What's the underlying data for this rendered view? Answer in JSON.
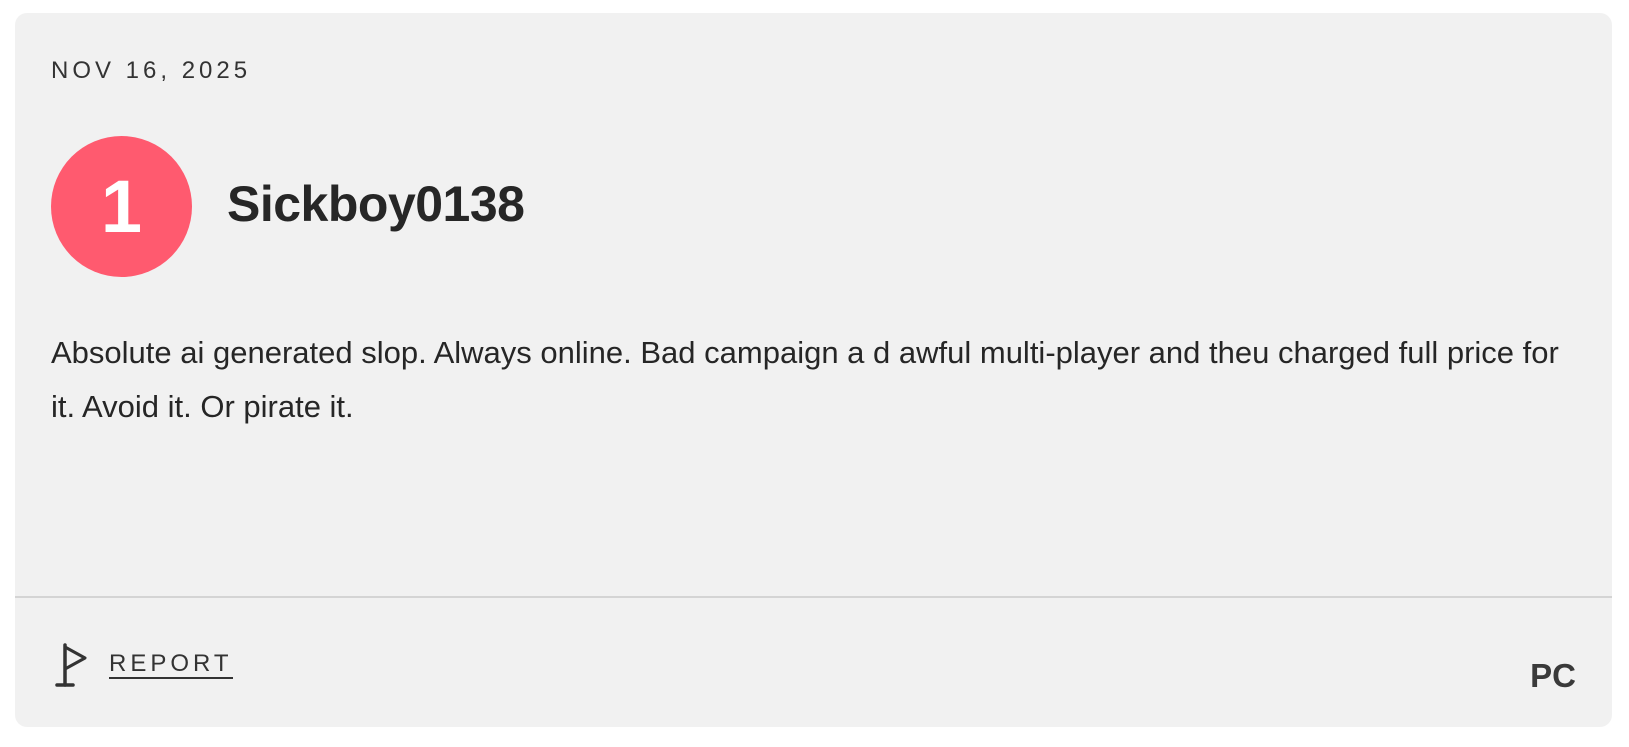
{
  "review": {
    "date": "NOV 16, 2025",
    "score": "1",
    "score_color": "#ff5a6f",
    "username": "Sickboy0138",
    "text": "Absolute ai generated slop. Always online. Bad campaign a d awful multi-player and theu charged full price for it. Avoid it. Or pirate it.",
    "platform": "PC"
  },
  "footer": {
    "report_label": "REPORT",
    "report_icon": "flag-icon"
  }
}
